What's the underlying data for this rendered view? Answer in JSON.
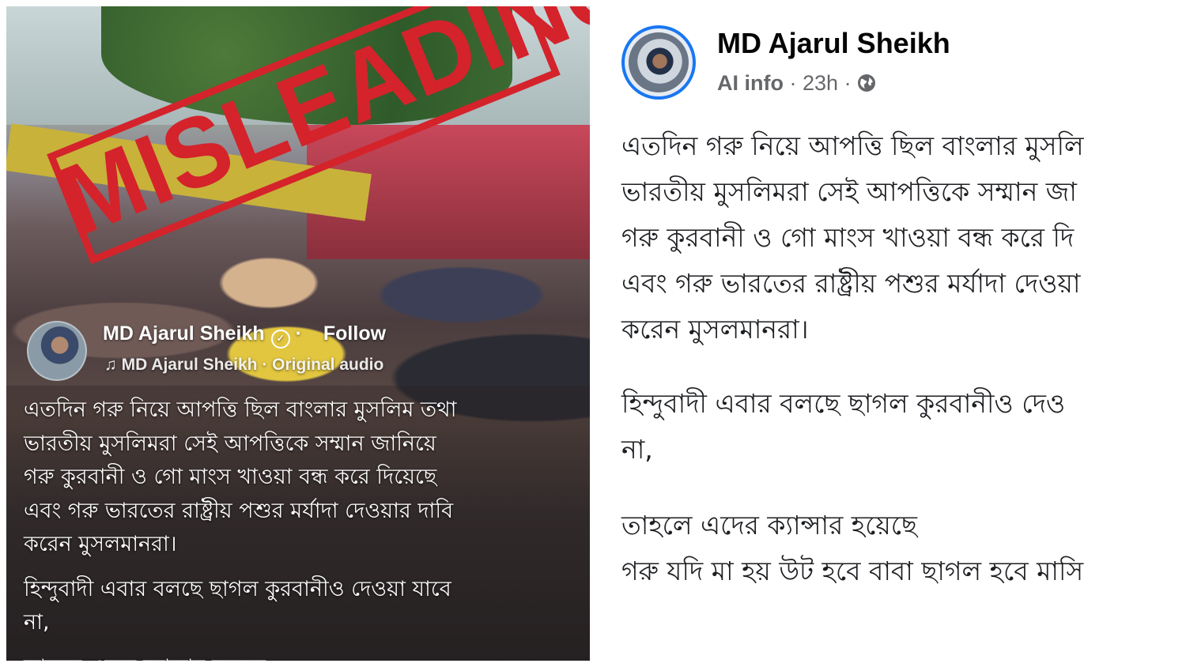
{
  "stamp": {
    "text": "MISLEADING",
    "color": "#d4232b"
  },
  "video_overlay": {
    "author_name": "MD Ajarul Sheikh",
    "follow_label": "Follow",
    "audio_label": "♫ MD Ajarul Sheikh · Original audio",
    "caption_lines": [
      "এতদিন গরু নিয়ে আপত্তি ছিল বাংলার মুসলিম তথা",
      "ভারতীয় মুসলিমরা সেই আপত্তিকে সম্মান জানিয়ে",
      "গরু কুরবানী ও গো মাংস খাওয়া বন্ধ করে দিয়েছে",
      "এবং গরু ভারতের রাষ্ট্রীয় পশুর মর্যাদা দেওয়ার দাবি",
      "করেন মুসলমানরা।",
      " হিন্দুবাদী এবার বলছে ছাগল কুরবানীও দেওয়া যাবে",
      "না,",
      "তাহলে এদের ক্যান্সার হয়েছে"
    ]
  },
  "post": {
    "author_name": "MD Ajarul Sheikh",
    "meta": {
      "ai_info": "AI info",
      "separator": "·",
      "time": "23h",
      "audience_icon": "globe-icon"
    },
    "accent_color": "#1877f2",
    "paragraph_1": [
      "এতদিন গরু নিয়ে আপত্তি ছিল বাংলার মুসলি",
      "ভারতীয় মুসলিমরা সেই আপত্তিকে সম্মান জা",
      "গরু কুরবানী ও গো মাংস খাওয়া বন্ধ করে দি",
      "এবং গরু ভারতের রাষ্ট্রীয় পশুর মর্যাদা দেওয়া",
      "করেন মুসলমানরা।"
    ],
    "paragraph_2": [
      " হিন্দুবাদী এবার বলছে ছাগল কুরবানীও দেও",
      "না,"
    ],
    "paragraph_3": [
      "তাহলে এদের ক্যান্সার হয়েছে",
      "গরু যদি মা হয় উট হবে বাবা ছাগল হবে মাসি"
    ]
  }
}
